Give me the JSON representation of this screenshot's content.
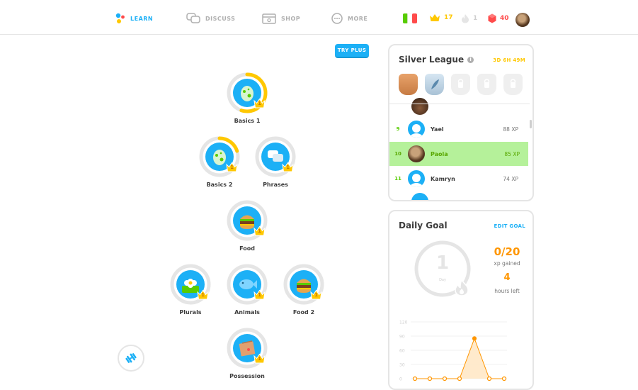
{
  "nav": {
    "learn": "LEARN",
    "discuss": "DISCUSS",
    "shop": "SHOP",
    "more": "MORE"
  },
  "stats": {
    "crowns": "17",
    "streak": "1",
    "gems": "40"
  },
  "try_plus": "TRY PLUS",
  "skills": [
    {
      "label": "Basics 1",
      "crown": "1",
      "icon": "egg-icon",
      "progress": 0.55
    },
    {
      "label": "Basics 2",
      "crown": "1",
      "icon": "egg-icon",
      "progress": 0.2
    },
    {
      "label": "Phrases",
      "crown": "1",
      "icon": "speech-bubbles-icon",
      "progress": 0
    },
    {
      "label": "Food",
      "crown": "1",
      "icon": "burger-icon",
      "progress": 0
    },
    {
      "label": "Plurals",
      "crown": "1",
      "icon": "flower-icon",
      "progress": 0
    },
    {
      "label": "Animals",
      "crown": "1",
      "icon": "fish-icon",
      "progress": 0
    },
    {
      "label": "Food 2",
      "crown": "1",
      "icon": "burger-icon",
      "progress": 0
    },
    {
      "label": "Possession",
      "crown": "1",
      "icon": "box-icon",
      "progress": 0
    }
  ],
  "league": {
    "title": "Silver League",
    "timer": "3D 6H 49M",
    "rows": [
      {
        "rank": "9",
        "name": "Yael",
        "xp": "88 XP"
      },
      {
        "rank": "10",
        "name": "Paola",
        "xp": "85 XP"
      },
      {
        "rank": "11",
        "name": "Kamryn",
        "xp": "74 XP"
      }
    ]
  },
  "goal": {
    "title": "Daily Goal",
    "edit": "EDIT GOAL",
    "day": "1",
    "day_label": "Day",
    "xp": "0/20",
    "xp_label": "xp gained",
    "hours": "4",
    "hours_label": "hours left"
  },
  "chart_data": {
    "type": "line",
    "y_ticks": [
      "120",
      "90",
      "60",
      "30",
      "0"
    ],
    "ylim": [
      0,
      120
    ],
    "values": [
      0,
      0,
      0,
      0,
      85,
      0,
      0
    ],
    "color": "#ff9600"
  },
  "colors": {
    "blue": "#1cb0f6",
    "gold": "#ffc800",
    "orange": "#ff9600",
    "green": "#58cc02",
    "red": "#ff4b4b"
  }
}
